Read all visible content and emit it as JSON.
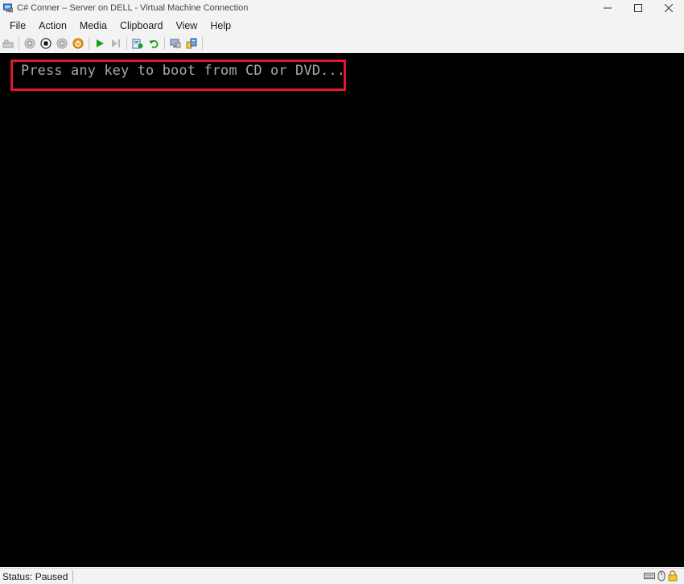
{
  "window": {
    "title": "C# Conner – Server on DELL - Virtual Machine Connection",
    "app_icon": "vm-connection-icon",
    "controls": [
      "minimize-icon",
      "maximize-icon",
      "close-icon"
    ]
  },
  "menu": {
    "items": [
      {
        "label": "File"
      },
      {
        "label": "Action"
      },
      {
        "label": "Media"
      },
      {
        "label": "Clipboard"
      },
      {
        "label": "View"
      },
      {
        "label": "Help"
      }
    ]
  },
  "toolbar": {
    "buttons": [
      "ctrl-alt-del-icon",
      "start-icon",
      "turn-off-icon",
      "shutdown-icon",
      "save-icon",
      "pause-icon",
      "reset-icon",
      "checkpoint-icon",
      "revert-icon",
      "enhanced-session-icon",
      "share-icon"
    ],
    "colors": {
      "play": "#1e9e1e",
      "save": "#e08a00",
      "revert": "#1e9e1e"
    }
  },
  "console": {
    "text": "Press any key to boot from CD or DVD...",
    "text_color": "#a8a8a8",
    "background": "#000000",
    "highlight_color": "#e3162b"
  },
  "status": {
    "text": "Status: Paused",
    "icons": [
      "keyboard-icon",
      "mouse-icon",
      "lock-icon"
    ]
  }
}
